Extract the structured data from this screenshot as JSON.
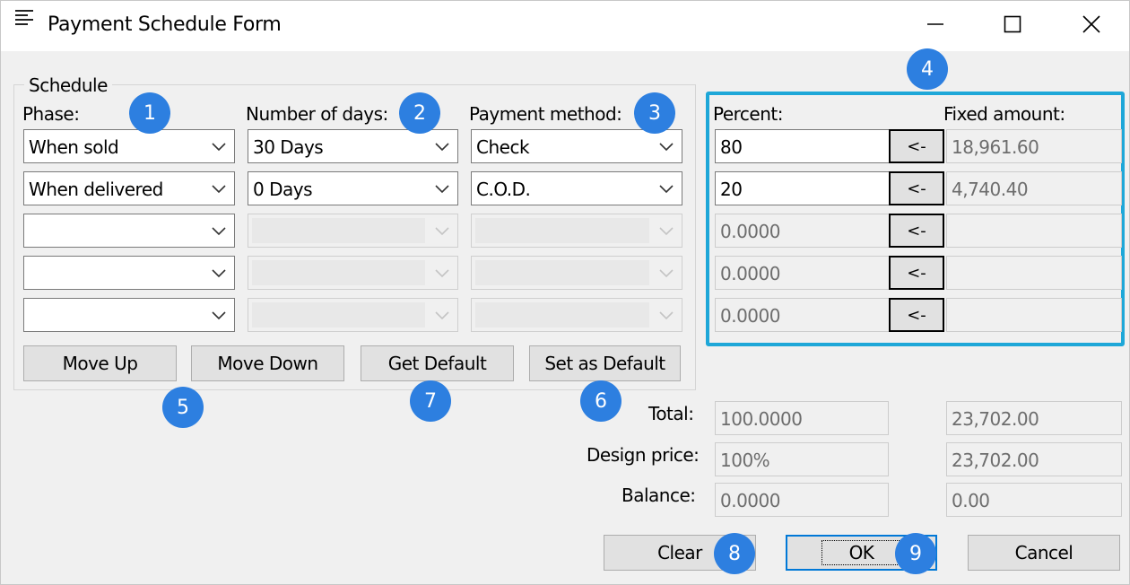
{
  "window": {
    "title": "Payment Schedule Form",
    "controls": {
      "minimize": "—",
      "maximize": "☐",
      "close": "✕"
    }
  },
  "schedule": {
    "group_label": "Schedule",
    "headers": {
      "phase": "Phase:",
      "days": "Number of days:",
      "method": "Payment method:"
    },
    "rows": [
      {
        "phase": "When sold",
        "days": "30 Days",
        "method": "Check",
        "percent": "80",
        "fixed": "18,961.60",
        "enabled": true
      },
      {
        "phase": "When delivered",
        "days": "0 Days",
        "method": "C.O.D.",
        "percent": "20",
        "fixed": "4,740.40",
        "enabled": true
      },
      {
        "phase": "",
        "days": "",
        "method": "",
        "percent": "0.0000",
        "fixed": "",
        "enabled": false
      },
      {
        "phase": "",
        "days": "",
        "method": "",
        "percent": "0.0000",
        "fixed": "",
        "enabled": false
      },
      {
        "phase": "",
        "days": "",
        "method": "",
        "percent": "0.0000",
        "fixed": "",
        "enabled": false
      }
    ],
    "buttons": {
      "move_up": "Move Up",
      "move_down": "Move Down",
      "get_default": "Get Default",
      "set_default": "Set as Default"
    }
  },
  "amounts": {
    "percent_header": "Percent:",
    "fixed_header": "Fixed amount:",
    "arrow_label": "<-"
  },
  "totals": {
    "total_label": "Total:",
    "total_percent": "100.0000",
    "total_amount": "23,702.00",
    "design_label": "Design price:",
    "design_percent": "100%",
    "design_amount": "23,702.00",
    "balance_label": "Balance:",
    "balance_percent": "0.0000",
    "balance_amount": "0.00"
  },
  "footer": {
    "clear": "Clear",
    "ok": "OK",
    "cancel": "Cancel"
  },
  "badges": [
    "1",
    "2",
    "3",
    "4",
    "5",
    "6",
    "7",
    "8",
    "9"
  ],
  "colors": {
    "highlight": "#1ea7d8",
    "badge": "#2d7fe0"
  }
}
